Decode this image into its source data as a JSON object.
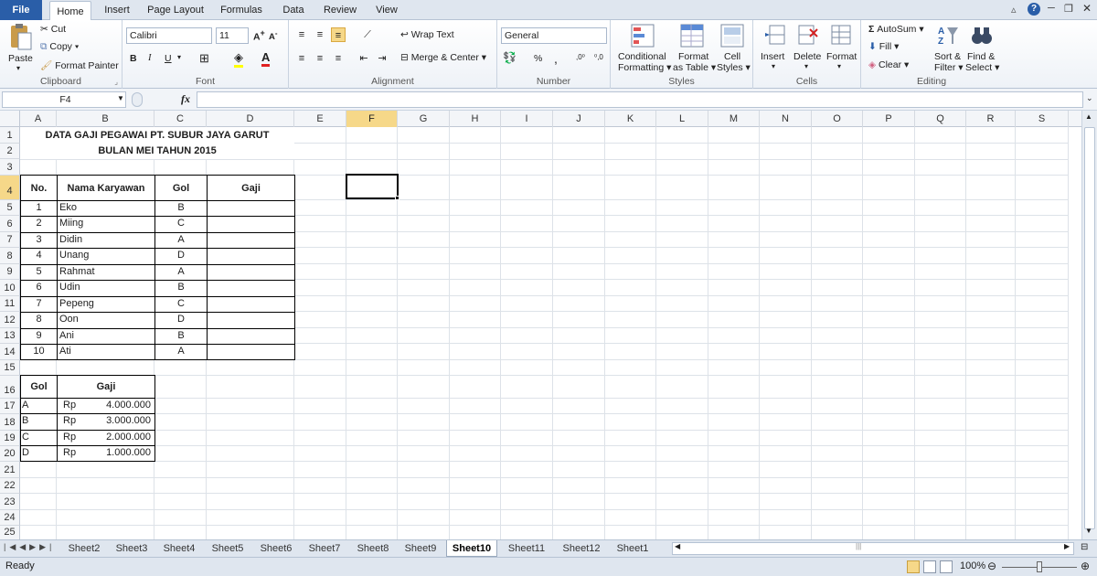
{
  "ribbon_tabs": [
    "File",
    "Home",
    "Insert",
    "Page Layout",
    "Formulas",
    "Data",
    "Review",
    "View"
  ],
  "clipboard": {
    "paste": "Paste",
    "cut": "Cut",
    "copy": "Copy",
    "format_painter": "Format Painter",
    "label": "Clipboard"
  },
  "font": {
    "name": "Calibri",
    "size": "11",
    "bold": "B",
    "italic": "I",
    "underline": "U",
    "label": "Font"
  },
  "alignment": {
    "wrap_text": "Wrap Text",
    "merge_center": "Merge & Center",
    "label": "Alignment"
  },
  "number": {
    "format": "General",
    "percent": "%",
    "comma": ",",
    "label": "Number"
  },
  "styles": {
    "conditional": "Conditional",
    "formatting": "Formatting",
    "format": "Format",
    "as_table": "as Table",
    "cell": "Cell",
    "cell_styles": "Styles",
    "label": "Styles"
  },
  "cells": {
    "insert": "Insert",
    "delete": "Delete",
    "format": "Format",
    "label": "Cells"
  },
  "editing": {
    "autosum": "AutoSum",
    "fill": "Fill",
    "clear": "Clear",
    "sort": "Sort &",
    "filter": "Filter",
    "find": "Find &",
    "select": "Select",
    "label": "Editing"
  },
  "formula_bar": {
    "name_box": "F4",
    "fx": "fx",
    "formula": ""
  },
  "columns": [
    "A",
    "B",
    "C",
    "D",
    "E",
    "F",
    "G",
    "H",
    "I",
    "J",
    "K",
    "L",
    "M",
    "N",
    "O",
    "P",
    "Q",
    "R",
    "S"
  ],
  "rows": [
    "1",
    "2",
    "3",
    "4",
    "5",
    "6",
    "7",
    "8",
    "9",
    "10",
    "11",
    "12",
    "13",
    "14",
    "15",
    "16",
    "17",
    "18",
    "19",
    "20",
    "21",
    "22",
    "23",
    "24",
    "25"
  ],
  "sheet": {
    "title1": "DATA GAJI PEGAWAI PT. SUBUR JAYA GARUT",
    "title2": "BULAN MEI TAHUN 2015",
    "headers": {
      "no": "No.",
      "nama": "Nama Karyawan",
      "gol": "Gol",
      "gaji": "Gaji"
    },
    "employees": [
      {
        "no": "1",
        "nama": "Eko",
        "gol": "B"
      },
      {
        "no": "2",
        "nama": "Miing",
        "gol": "C"
      },
      {
        "no": "3",
        "nama": "Didin",
        "gol": "A"
      },
      {
        "no": "4",
        "nama": "Unang",
        "gol": "D"
      },
      {
        "no": "5",
        "nama": "Rahmat",
        "gol": "A"
      },
      {
        "no": "6",
        "nama": "Udin",
        "gol": "B"
      },
      {
        "no": "7",
        "nama": "Pepeng",
        "gol": "C"
      },
      {
        "no": "8",
        "nama": "Oon",
        "gol": "D"
      },
      {
        "no": "9",
        "nama": "Ani",
        "gol": "B"
      },
      {
        "no": "10",
        "nama": "Ati",
        "gol": "A"
      }
    ],
    "lookup_headers": {
      "gol": "Gol",
      "gaji": "Gaji"
    },
    "lookup": [
      {
        "gol": "A",
        "cur": "Rp",
        "gaji": "4.000.000"
      },
      {
        "gol": "B",
        "cur": "Rp",
        "gaji": "3.000.000"
      },
      {
        "gol": "C",
        "cur": "Rp",
        "gaji": "2.000.000"
      },
      {
        "gol": "D",
        "cur": "Rp",
        "gaji": "1.000.000"
      }
    ]
  },
  "sheet_tabs": [
    "Sheet2",
    "Sheet3",
    "Sheet4",
    "Sheet5",
    "Sheet6",
    "Sheet7",
    "Sheet8",
    "Sheet9",
    "Sheet10",
    "Sheet11",
    "Sheet12",
    "Sheet1"
  ],
  "active_sheet": "Sheet10",
  "status": {
    "ready": "Ready",
    "zoom": "100%"
  },
  "colors": {
    "file_tab": "#2a5ea8",
    "selected_header": "#f6d889"
  }
}
